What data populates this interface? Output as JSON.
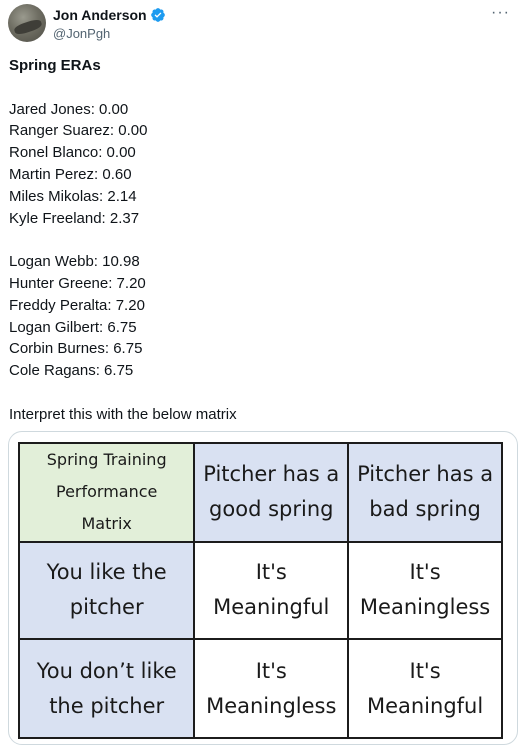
{
  "author": {
    "name": "Jon Anderson",
    "handle": "@JonPgh",
    "verified_icon": "verified-badge-icon",
    "more_icon": "more-options-icon",
    "accent_color": "#1d9bf0"
  },
  "tweet": {
    "title": "Spring ERAs",
    "good_list": [
      "Jared Jones: 0.00",
      "Ranger Suarez: 0.00",
      "Ronel Blanco: 0.00",
      "Martin Perez: 0.60",
      "Miles Mikolas: 2.14",
      "Kyle Freeland: 2.37"
    ],
    "bad_list": [
      "Logan Webb: 10.98",
      "Hunter Greene: 7.20",
      "Freddy Peralta: 7.20",
      "Logan Gilbert: 6.75",
      "Corbin Burnes: 6.75",
      "Cole Ragans: 6.75"
    ],
    "closing": "Interpret this with the below matrix"
  },
  "matrix": {
    "corner": [
      "Spring Training",
      "Performance",
      "Matrix"
    ],
    "col_headers": [
      [
        "Pitcher has a",
        "good spring"
      ],
      [
        "Pitcher has a",
        "bad spring"
      ]
    ],
    "rows": [
      {
        "header": [
          "You like the",
          "pitcher"
        ],
        "cells": [
          [
            "It's",
            "Meaningful"
          ],
          [
            "It's",
            "Meaningless"
          ]
        ]
      },
      {
        "header": [
          "You don’t like",
          "the pitcher"
        ],
        "cells": [
          [
            "It's",
            "Meaningless"
          ],
          [
            "It's",
            "Meaningful"
          ]
        ]
      }
    ],
    "colors": {
      "corner_bg": "#e2efd9",
      "header_bg": "#d9e1f2",
      "cell_bg": "#ffffff"
    }
  }
}
